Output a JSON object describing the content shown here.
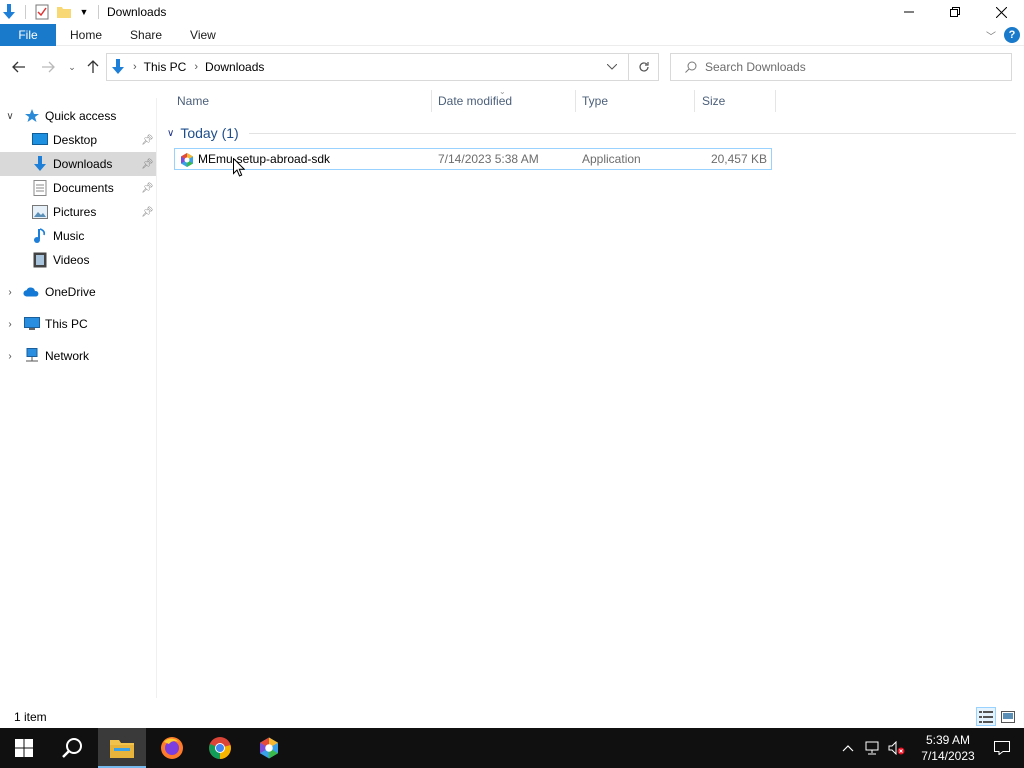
{
  "window": {
    "title": "Downloads",
    "buttons": {
      "minimize_icon": "minimize-icon",
      "restore_icon": "restore-icon",
      "close_icon": "close-icon"
    }
  },
  "ribbon": {
    "tabs": [
      {
        "label": "File"
      },
      {
        "label": "Home"
      },
      {
        "label": "Share"
      },
      {
        "label": "View"
      }
    ]
  },
  "navbar": {
    "breadcrumb": [
      "This PC",
      "Downloads"
    ],
    "search_placeholder": "Search Downloads"
  },
  "sidebar": {
    "items": [
      {
        "label": "Quick access",
        "icon": "star-icon",
        "expanded": true
      },
      {
        "label": "Desktop",
        "icon": "desktop-icon",
        "pinned": true
      },
      {
        "label": "Downloads",
        "icon": "download-icon",
        "pinned": true,
        "selected": true
      },
      {
        "label": "Documents",
        "icon": "documents-icon",
        "pinned": true
      },
      {
        "label": "Pictures",
        "icon": "pictures-icon",
        "pinned": true
      },
      {
        "label": "Music",
        "icon": "music-icon"
      },
      {
        "label": "Videos",
        "icon": "videos-icon"
      },
      {
        "label": "OneDrive",
        "icon": "cloud-icon"
      },
      {
        "label": "This PC",
        "icon": "computer-icon"
      },
      {
        "label": "Network",
        "icon": "network-icon"
      }
    ]
  },
  "columns": [
    "Name",
    "Date modified",
    "Type",
    "Size"
  ],
  "group": {
    "label": "Today (1)"
  },
  "files": [
    {
      "name": "MEmu-setup-abroad-sdk",
      "date": "7/14/2023 5:38 AM",
      "type": "Application",
      "size": "20,457 KB"
    }
  ],
  "status": {
    "count": "1 item"
  },
  "taskbar": {
    "apps": [
      "start-icon",
      "search-icon",
      "file-explorer-icon",
      "firefox-icon",
      "chrome-icon",
      "memu-icon"
    ],
    "time": "5:39 AM",
    "date": "7/14/2023"
  },
  "colors": {
    "accent": "#1979ca",
    "selection": "#d9d9d9",
    "taskbar": "#101010"
  }
}
